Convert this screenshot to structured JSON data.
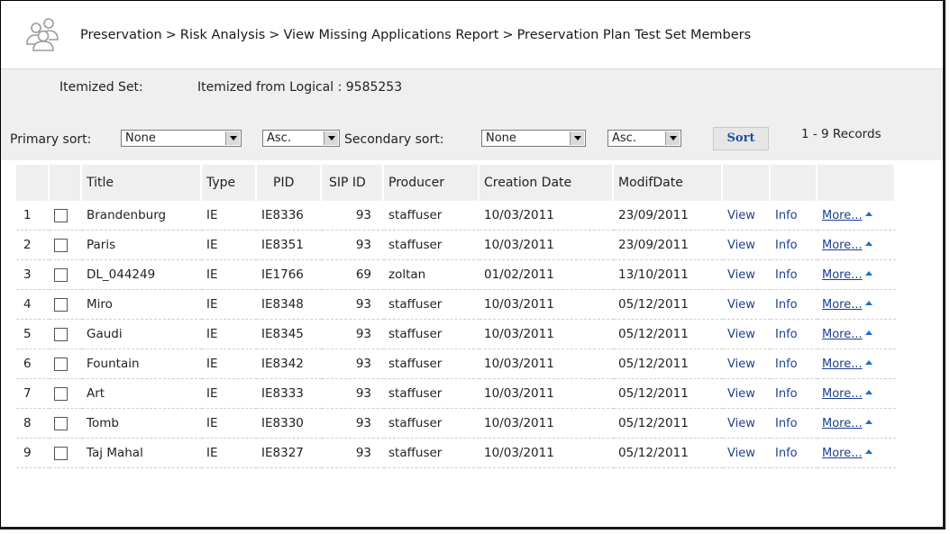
{
  "breadcrumb": [
    "Preservation",
    "Risk Analysis",
    "View Missing Applications Report",
    "Preservation Plan Test Set Members"
  ],
  "breadcrumb_separator": ">",
  "itemized": {
    "label": "Itemized Set:",
    "value": "Itemized from Logical : 9585253"
  },
  "sort": {
    "primary_label": "Primary sort:",
    "primary_value": "None",
    "primary_order": "Asc.",
    "secondary_label": "Secondary sort:",
    "secondary_value": "None",
    "secondary_order": "Asc.",
    "button": "Sort",
    "records": "1 - 9  Records"
  },
  "columns": [
    "",
    "",
    "Title",
    "Type",
    "PID",
    "SIP ID",
    "Producer",
    "Creation Date",
    "ModifDate",
    "",
    "",
    ""
  ],
  "actions": {
    "view": "View",
    "info": "Info",
    "more": "More..."
  },
  "rows": [
    {
      "n": "1",
      "title": "Brandenburg",
      "type": "IE",
      "pid": "IE8336",
      "sip": "93",
      "producer": "staffuser",
      "created": "10/03/2011",
      "modified": "23/09/2011"
    },
    {
      "n": "2",
      "title": "Paris",
      "type": "IE",
      "pid": "IE8351",
      "sip": "93",
      "producer": "staffuser",
      "created": "10/03/2011",
      "modified": "23/09/2011"
    },
    {
      "n": "3",
      "title": "DL_044249",
      "type": "IE",
      "pid": "IE1766",
      "sip": "69",
      "producer": "zoltan",
      "created": "01/02/2011",
      "modified": "13/10/2011"
    },
    {
      "n": "4",
      "title": "Miro",
      "type": "IE",
      "pid": "IE8348",
      "sip": "93",
      "producer": "staffuser",
      "created": "10/03/2011",
      "modified": "05/12/2011"
    },
    {
      "n": "5",
      "title": "Gaudi",
      "type": "IE",
      "pid": "IE8345",
      "sip": "93",
      "producer": "staffuser",
      "created": "10/03/2011",
      "modified": "05/12/2011"
    },
    {
      "n": "6",
      "title": "Fountain",
      "type": "IE",
      "pid": "IE8342",
      "sip": "93",
      "producer": "staffuser",
      "created": "10/03/2011",
      "modified": "05/12/2011"
    },
    {
      "n": "7",
      "title": "Art",
      "type": "IE",
      "pid": "IE8333",
      "sip": "93",
      "producer": "staffuser",
      "created": "10/03/2011",
      "modified": "05/12/2011"
    },
    {
      "n": "8",
      "title": "Tomb",
      "type": "IE",
      "pid": "IE8330",
      "sip": "93",
      "producer": "staffuser",
      "created": "10/03/2011",
      "modified": "05/12/2011"
    },
    {
      "n": "9",
      "title": "Taj Mahal",
      "type": "IE",
      "pid": "IE8327",
      "sip": "93",
      "producer": "staffuser",
      "created": "10/03/2011",
      "modified": "05/12/2011"
    }
  ],
  "colors": {
    "link": "#1f3f8f",
    "header_bg": "#efefef",
    "more_arrow": "#1f6fd0"
  },
  "icons": {
    "logo": "users-group-icon",
    "dropdown": "dropdown-arrow-icon",
    "more": "triangle-up-icon"
  }
}
